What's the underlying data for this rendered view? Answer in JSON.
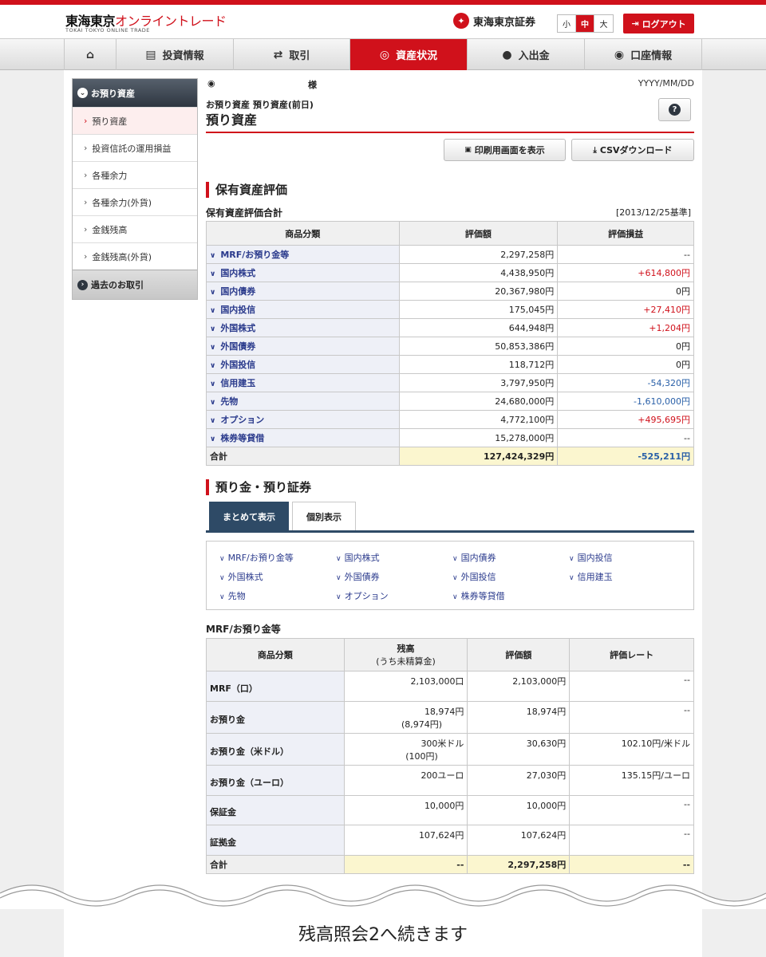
{
  "header": {
    "logo_main": "東海東京",
    "logo_red": "オンライントレード",
    "logo_sub": "TOKAI TOKYO ONLINE TRADE",
    "brand": "東海東京証券",
    "font_sizes": [
      "小",
      "中",
      "大"
    ],
    "logout": "ログアウト"
  },
  "nav": {
    "items": [
      {
        "label": "",
        "icon": "home-icon"
      },
      {
        "label": "投資情報",
        "icon": "chart-board-icon"
      },
      {
        "label": "取引",
        "icon": "trade-arrows-icon"
      },
      {
        "label": "資産状況",
        "icon": "coins-icon"
      },
      {
        "label": "入出金",
        "icon": "money-bag-icon"
      },
      {
        "label": "口座情報",
        "icon": "user-icon"
      }
    ],
    "active_color": "#d0111b"
  },
  "sidebar": {
    "head": "お預り資産",
    "items": [
      "預り資産",
      "投資信託の運用損益",
      "各種余力",
      "各種余力(外貨)",
      "金銭残高",
      "金銭残高(外貨)"
    ],
    "past": "過去のお取引"
  },
  "page": {
    "user_suffix": "様",
    "date": "YYYY/MM/DD",
    "breadcrumb": "お預り資産 預り資産(前日)",
    "title": "預り資産",
    "print_btn": "印刷用画面を表示",
    "csv_btn": "CSVダウンロード"
  },
  "holdings": {
    "section_title": "保有資産評価",
    "sub_title": "保有資産評価合計",
    "base_date": "[2013/12/25基準]",
    "headers": [
      "商品分類",
      "評価額",
      "評価損益"
    ],
    "rows": [
      {
        "cat": "MRF/お預り金等",
        "value": "2,297,258円",
        "pl": "--"
      },
      {
        "cat": "国内株式",
        "value": "4,438,950円",
        "pl": "+614,800円"
      },
      {
        "cat": "国内債券",
        "value": "20,367,980円",
        "pl": "0円"
      },
      {
        "cat": "国内投信",
        "value": "175,045円",
        "pl": "+27,410円"
      },
      {
        "cat": "外国株式",
        "value": "644,948円",
        "pl": "+1,204円"
      },
      {
        "cat": "外国債券",
        "value": "50,853,386円",
        "pl": "0円"
      },
      {
        "cat": "外国投信",
        "value": "118,712円",
        "pl": "0円"
      },
      {
        "cat": "信用建玉",
        "value": "3,797,950円",
        "pl": "-54,320円"
      },
      {
        "cat": "先物",
        "value": "24,680,000円",
        "pl": "-1,610,000円"
      },
      {
        "cat": "オプション",
        "value": "4,772,100円",
        "pl": "+495,695円"
      },
      {
        "cat": "株券等貸借",
        "value": "15,278,000円",
        "pl": "--"
      }
    ],
    "total_label": "合計",
    "total_value": "127,424,329円",
    "total_pl": "-525,211円"
  },
  "deposits": {
    "section_title": "預り金・預り証券",
    "tabs": [
      "まとめて表示",
      "個別表示"
    ],
    "links": [
      "MRF/お預り金等",
      "国内株式",
      "国内債券",
      "国内投信",
      "外国株式",
      "外国債券",
      "外国投信",
      "信用建玉",
      "先物",
      "オプション",
      "株券等貸借"
    ],
    "sub_title": "MRF/お預り金等",
    "headers": [
      "商品分類",
      "残高",
      "(うち未精算金)",
      "評価額",
      "評価レート"
    ],
    "rows": [
      {
        "cat": "MRF（口）",
        "bal": "2,103,000口",
        "bal2": "",
        "value": "2,103,000円",
        "rate": "--"
      },
      {
        "cat": "お預り金",
        "bal": "18,974円",
        "bal2": "(8,974円)",
        "value": "18,974円",
        "rate": "--"
      },
      {
        "cat": "お預り金（米ドル）",
        "bal": "300米ドル",
        "bal2": "(100円)",
        "value": "30,630円",
        "rate": "102.10円/米ドル"
      },
      {
        "cat": "お預り金（ユーロ）",
        "bal": "200ユーロ",
        "bal2": "",
        "value": "27,030円",
        "rate": "135.15円/ユーロ"
      },
      {
        "cat": "保証金",
        "bal": "10,000円",
        "bal2": "",
        "value": "10,000円",
        "rate": "--"
      },
      {
        "cat": "証拠金",
        "bal": "107,624円",
        "bal2": "",
        "value": "107,624円",
        "rate": "--"
      }
    ],
    "total_label": "合計",
    "total_bal": "--",
    "total_value": "2,297,258円",
    "total_rate": "--"
  },
  "footer": {
    "continue_text": "残高照会2へ続きます"
  }
}
